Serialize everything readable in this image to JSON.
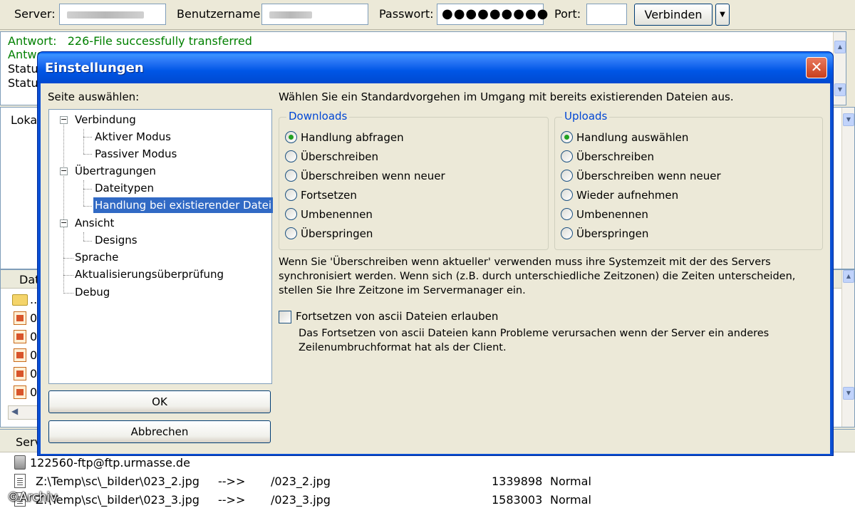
{
  "quickconnect": {
    "server_label": "Server:",
    "user_label": "Benutzername:",
    "password_label": "Passwort:",
    "password_value": "●●●●●●●●●",
    "port_label": "Port:",
    "port_value": "",
    "connect_label": "Verbinden"
  },
  "log": {
    "lines": [
      {
        "prefix": "Antwort:",
        "text": "226-File successfully transferred"
      },
      {
        "prefix": "Antwo",
        "text": ""
      },
      {
        "prefix": "Status",
        "text": ""
      },
      {
        "prefix": "Status",
        "text": ""
      }
    ]
  },
  "local_pane": {
    "label": "Lokal"
  },
  "file_pane": {
    "header": "Dat",
    "folder_name": "..",
    "rows": [
      "0",
      "0",
      "0",
      "0",
      "0"
    ]
  },
  "queue": {
    "header": "Serv",
    "server": "122560-ftp@ftp.urmasse.de",
    "rows": [
      {
        "local": "Z:\\Temp\\sc\\_bilder\\023_2.jpg",
        "dir": "-->>",
        "remote": "/023_2.jpg",
        "size": "1339898",
        "priority": "Normal"
      },
      {
        "local": "Z:\\Temp\\sc\\_bilder\\023_3.jpg",
        "dir": "-->>",
        "remote": "/023_3.jpg",
        "size": "1583003",
        "priority": "Normal"
      }
    ]
  },
  "watermark": "©Archiv",
  "dialog": {
    "title": "Einstellungen",
    "page_select_label": "Seite auswählen:",
    "tree": {
      "verbindung": "Verbindung",
      "aktiver_modus": "Aktiver Modus",
      "passiver_modus": "Passiver Modus",
      "uebertragungen": "Übertragungen",
      "dateitypen": "Dateitypen",
      "handlung": "Handlung bei existierender Datei",
      "ansicht": "Ansicht",
      "designs": "Designs",
      "sprache": "Sprache",
      "update": "Aktualisierungsüberprüfung",
      "debug": "Debug"
    },
    "ok_label": "OK",
    "cancel_label": "Abbrechen",
    "intro": "Wählen Sie ein Standardvorgehen im Umgang mit bereits existierenden Dateien aus.",
    "downloads": {
      "title": "Downloads",
      "selected": 0,
      "options": [
        "Handlung abfragen",
        "Überschreiben",
        "Überschreiben wenn neuer",
        "Fortsetzen",
        "Umbenennen",
        "Überspringen"
      ]
    },
    "uploads": {
      "title": "Uploads",
      "selected": 0,
      "options": [
        "Handlung auswählen",
        "Überschreiben",
        "Überschreiben wenn neuer",
        "Wieder aufnehmen",
        "Umbenennen",
        "Überspringen"
      ]
    },
    "note_lines": [
      "Wenn Sie 'Überschreiben wenn aktueller' verwenden muss ihre Systemzeit mit der des Servers",
      "synchronisiert werden. Wenn sich (z.B. durch unterschiedliche Zeitzonen) die Zeiten unterscheiden,",
      "stellen Sie Ihre Zeitzone im Servermanager ein."
    ],
    "ascii_checkbox_label": "Fortsetzen von ascii Dateien erlauben",
    "ascii_checked": false,
    "help_lines": [
      "Das Fortsetzen von ascii Dateien kann Probleme verursachen wenn der Server ein anderes",
      "Zeilenumbruchformat hat als der Client."
    ]
  }
}
